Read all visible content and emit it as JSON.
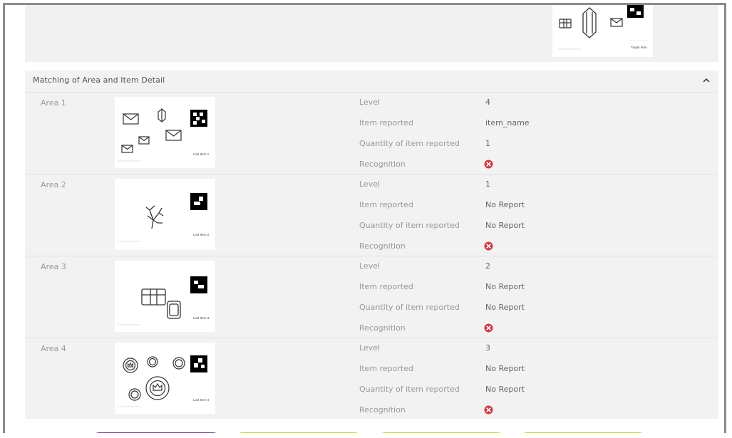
{
  "target_panel": {
    "caption": "Target Item"
  },
  "detail": {
    "title": "Matching of Area and Item Detail",
    "labels": {
      "level": "Level",
      "item": "Item reported",
      "quantity": "Quantity of item reported",
      "recognition": "Recognition"
    },
    "areas": [
      {
        "name": "Area 1",
        "caption": "Lost Item 1",
        "level": "4",
        "item": "item_name",
        "quantity": "1",
        "recognition": "error-icon"
      },
      {
        "name": "Area 2",
        "caption": "Lost Item 2",
        "level": "1",
        "item": "No Report",
        "quantity": "No Report",
        "recognition": "error-icon"
      },
      {
        "name": "Area 3",
        "caption": "Lost Item 3",
        "level": "2",
        "item": "No Report",
        "quantity": "No Report",
        "recognition": "error-icon"
      },
      {
        "name": "Area 4",
        "caption": "Lost Item 4",
        "level": "3",
        "item": "No Report",
        "quantity": "No Report",
        "recognition": "error-icon"
      }
    ]
  },
  "colors": {
    "error": "#d9363e",
    "btn_purple": "#8d3fa8",
    "btn_lime": "#c4df2a"
  }
}
